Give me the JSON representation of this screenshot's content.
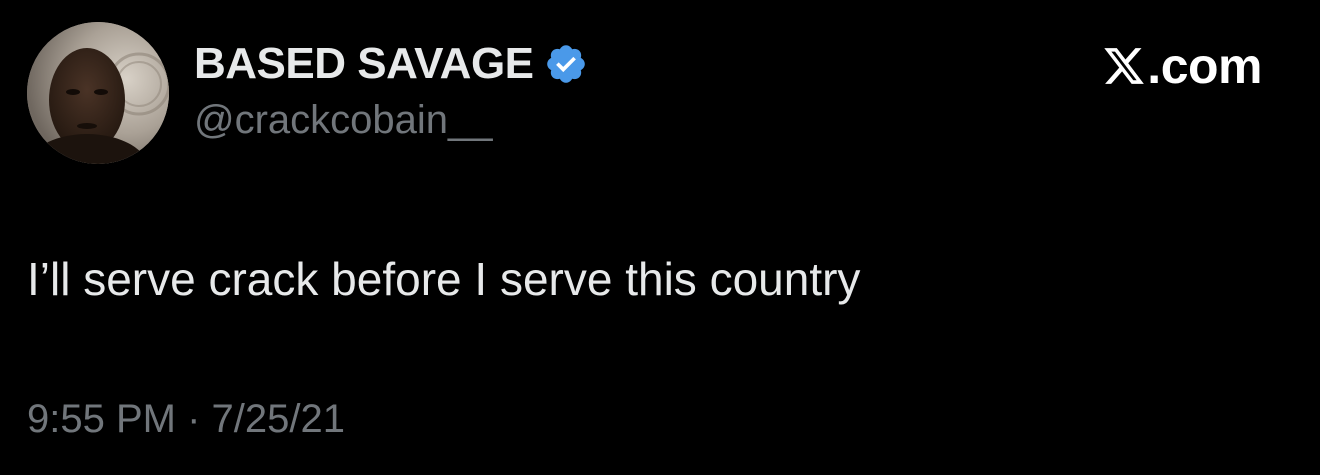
{
  "author": {
    "display_name": "BASED SAVAGE",
    "handle": "@crackcobain__",
    "verified": true,
    "verified_icon": "verified-badge-icon",
    "badge_color": "#4a99e9"
  },
  "site": {
    "logo_icon": "x-logo-icon",
    "domain": ".com"
  },
  "tweet": {
    "text": "I’ll serve crack before I serve this country",
    "time": "9:55 PM",
    "separator": "·",
    "date": "7/25/21"
  },
  "colors": {
    "background": "#000000",
    "primary_text": "#e7e9ea",
    "secondary_text": "#71767b"
  }
}
